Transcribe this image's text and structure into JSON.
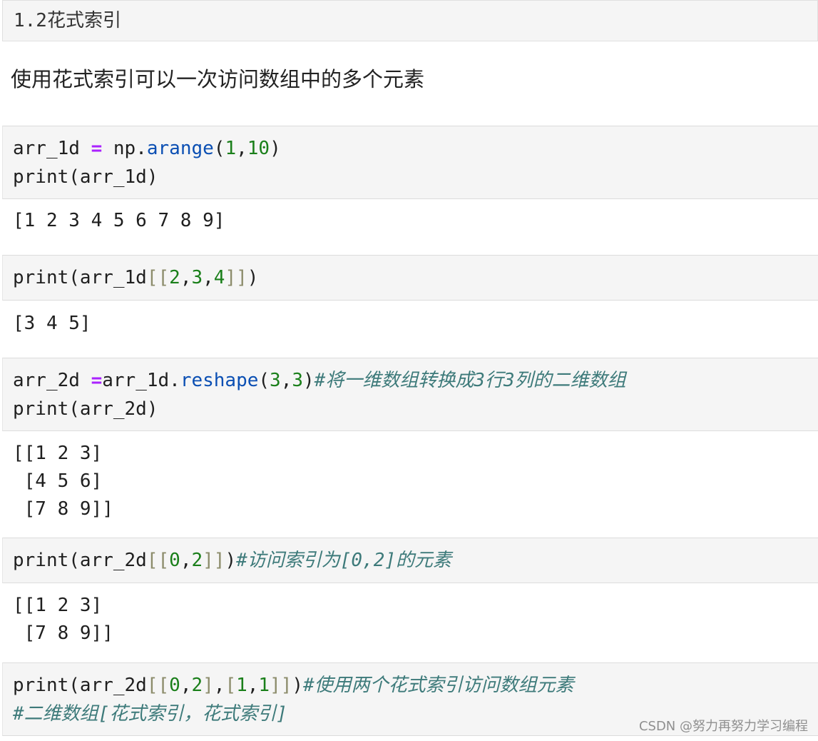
{
  "heading": "1.2花式索引",
  "intro": "使用花式索引可以一次访问数组中的多个元素",
  "cell1": {
    "line1": {
      "var": "arr_1d ",
      "op": "=",
      "sp": " np.",
      "fn": "arange",
      "open": "(",
      "n1": "1",
      "comma": ",",
      "n2": "10",
      "close": ")"
    },
    "line2": "print(arr_1d)"
  },
  "out1": "[1 2 3 4 5 6 7 8 9]",
  "cell2": {
    "pre": "print(arr_1d",
    "br_open": "[[",
    "n1": "2",
    "c1": ",",
    "n2": "3",
    "c2": ",",
    "n3": "4",
    "br_close": "]]",
    "post": ")"
  },
  "out2": "[3 4 5]",
  "cell3": {
    "line1": {
      "var": "arr_2d ",
      "op": "=",
      "obj": "arr_1d.",
      "fn": "reshape",
      "open": "(",
      "n1": "3",
      "comma": ",",
      "n2": "3",
      "close": ")",
      "comment": "#将一维数组转换成3行3列的二维数组"
    },
    "line2": "print(arr_2d)"
  },
  "out3": {
    "line1": "[[1 2 3]",
    "line2": " [4 5 6]",
    "line3": " [7 8 9]]"
  },
  "cell4": {
    "pre": "print(arr_2d",
    "br_open": "[[",
    "n1": "0",
    "c1": ",",
    "n2": "2",
    "br_close": "]]",
    "post": ")",
    "comment": "#访问索引为[0,2]的元素"
  },
  "out4": {
    "line1": "[[1 2 3]",
    "line2": " [7 8 9]]"
  },
  "cell5": {
    "line1": {
      "pre": "print(arr_2d",
      "br1_open": "[[",
      "n1": "0",
      "c1": ",",
      "n2": "2",
      "br1_close": "]",
      "c2": ",",
      "br2_open": "[",
      "n3": "1",
      "c3": ",",
      "n4": "1",
      "br2_close": "]]",
      "post": ")",
      "comment": "#使用两个花式索引访问数组元素"
    },
    "line2_comment": "#二维数组[花式索引，花式索引]"
  },
  "watermark": "CSDN @努力再努力学习编程"
}
